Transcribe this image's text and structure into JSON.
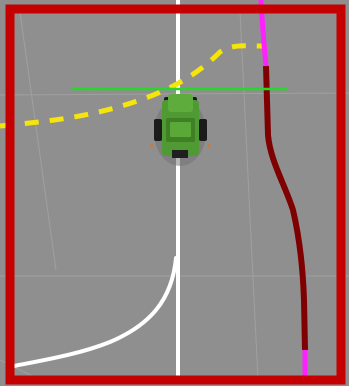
{
  "scene": {
    "description_free": true,
    "colors": {
      "ground": "#8f8f8f",
      "grid_line": "#a9a9a9",
      "boundary_frame": "#c40000",
      "center_line": "#ffffff",
      "dashed_path": "#f5e50a",
      "magenta_trail": "#ff21ff",
      "dark_red_trail": "#7f0000",
      "heading_line": "#28d828",
      "vehicle_body": "#4f9a32",
      "vehicle_tires": "#1b1b1b"
    },
    "icons": {
      "vehicle": "tractor-icon"
    }
  }
}
